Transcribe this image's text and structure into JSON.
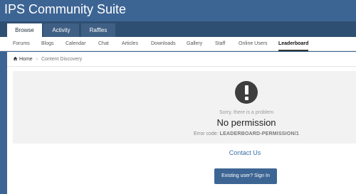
{
  "header": {
    "site_title": "IPS Community Suite"
  },
  "primary_nav": {
    "tabs": [
      {
        "label": "Browse",
        "active": true
      },
      {
        "label": "Activity",
        "active": false
      },
      {
        "label": "Raffles",
        "active": false
      }
    ]
  },
  "secondary_nav": {
    "items": [
      {
        "label": "Forums"
      },
      {
        "label": "Blogs"
      },
      {
        "label": "Calendar"
      },
      {
        "label": "Chat"
      },
      {
        "label": "Articles"
      },
      {
        "label": "Downloads"
      },
      {
        "label": "Gallery"
      },
      {
        "label": "Staff"
      },
      {
        "label": "Online Users"
      },
      {
        "label": "Leaderboard",
        "active": true
      }
    ]
  },
  "breadcrumb": {
    "home_label": "Home",
    "separator": "›",
    "current": "Content Discovery"
  },
  "error": {
    "subtitle": "Sorry, there is a problem",
    "title": "No permission",
    "code_label": "Error code:",
    "code": "LEADERBOARD-PERMISSION/1"
  },
  "contact_label": "Contact Us",
  "signin_label": "Existing user? Sign In",
  "colors": {
    "header_bg": "#3d6594",
    "nav_bg": "#2f4f72",
    "link": "#3a6ea5",
    "error_box_bg": "#f2f2f2"
  }
}
